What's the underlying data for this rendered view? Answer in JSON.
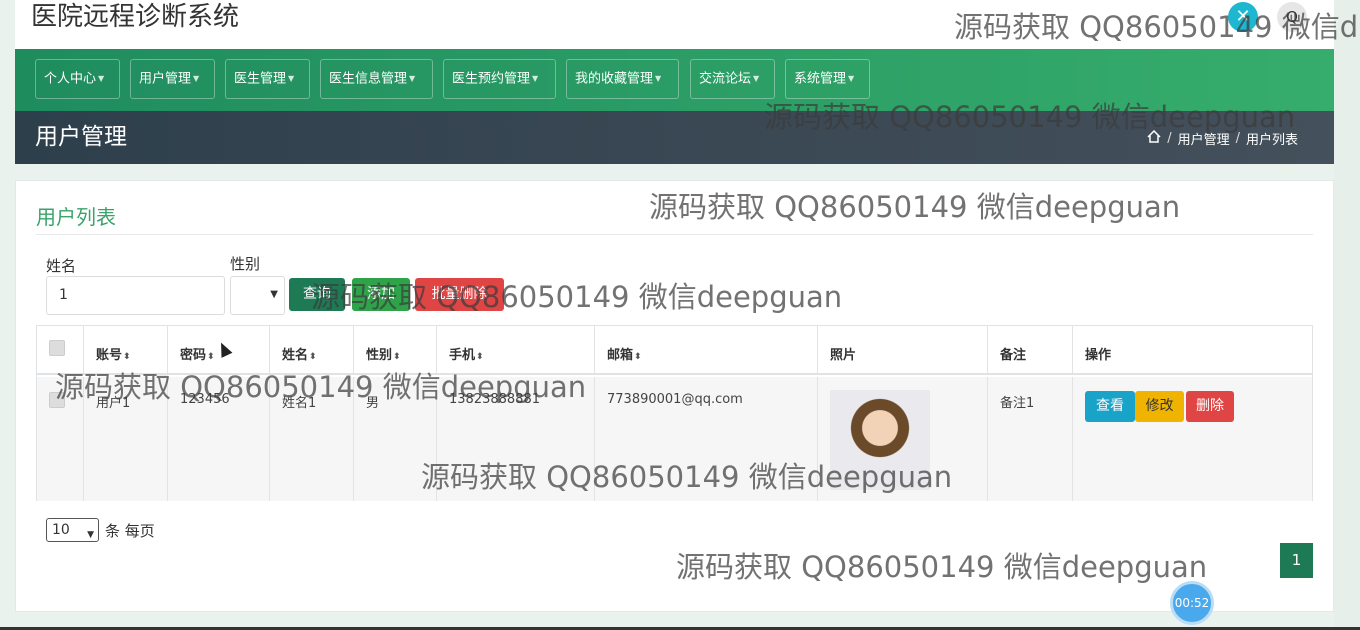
{
  "app": {
    "title": "医院远程诊断系统"
  },
  "nav": {
    "items": [
      {
        "label": "个人中心"
      },
      {
        "label": "用户管理"
      },
      {
        "label": "医生管理"
      },
      {
        "label": "医生信息管理"
      },
      {
        "label": "医生预约管理"
      },
      {
        "label": "我的收藏管理"
      },
      {
        "label": "交流论坛"
      },
      {
        "label": "系统管理"
      }
    ]
  },
  "pagehead": {
    "title": "用户管理",
    "breadcrumb": [
      "用户管理",
      "用户列表"
    ]
  },
  "card": {
    "title": "用户列表"
  },
  "search": {
    "name_label": "姓名",
    "name_value": "1",
    "gender_label": "性别",
    "gender_value": ""
  },
  "buttons": {
    "search": "查询",
    "add": "添加",
    "batch_delete": "批量删除"
  },
  "table": {
    "columns": [
      "账号",
      "密码",
      "姓名",
      "性别",
      "手机",
      "邮箱",
      "照片",
      "备注",
      "操作"
    ],
    "rows": [
      {
        "account": "用户1",
        "password": "123456",
        "name": "姓名1",
        "gender": "男",
        "phone": "13823888881",
        "email": "773890001@qq.com",
        "note": "备注1"
      }
    ],
    "actions": {
      "view": "查看",
      "edit": "修改",
      "delete": "删除"
    }
  },
  "pagination": {
    "page_size": "10",
    "per_page_text": "条 每页",
    "current_page": "1"
  },
  "overlay": {
    "close_icon": "✕",
    "user_icon": "Q",
    "timer": "00:52",
    "watermark": "源码获取 QQ86050149 微信deepguan",
    "watermark_top": "源码获取 QQ86050149 微信d"
  },
  "colors": {
    "accent": "#1e7a55",
    "nav": "#2a9a63",
    "danger": "#e04545",
    "info": "#1aa3c9",
    "warning": "#f0b400"
  }
}
